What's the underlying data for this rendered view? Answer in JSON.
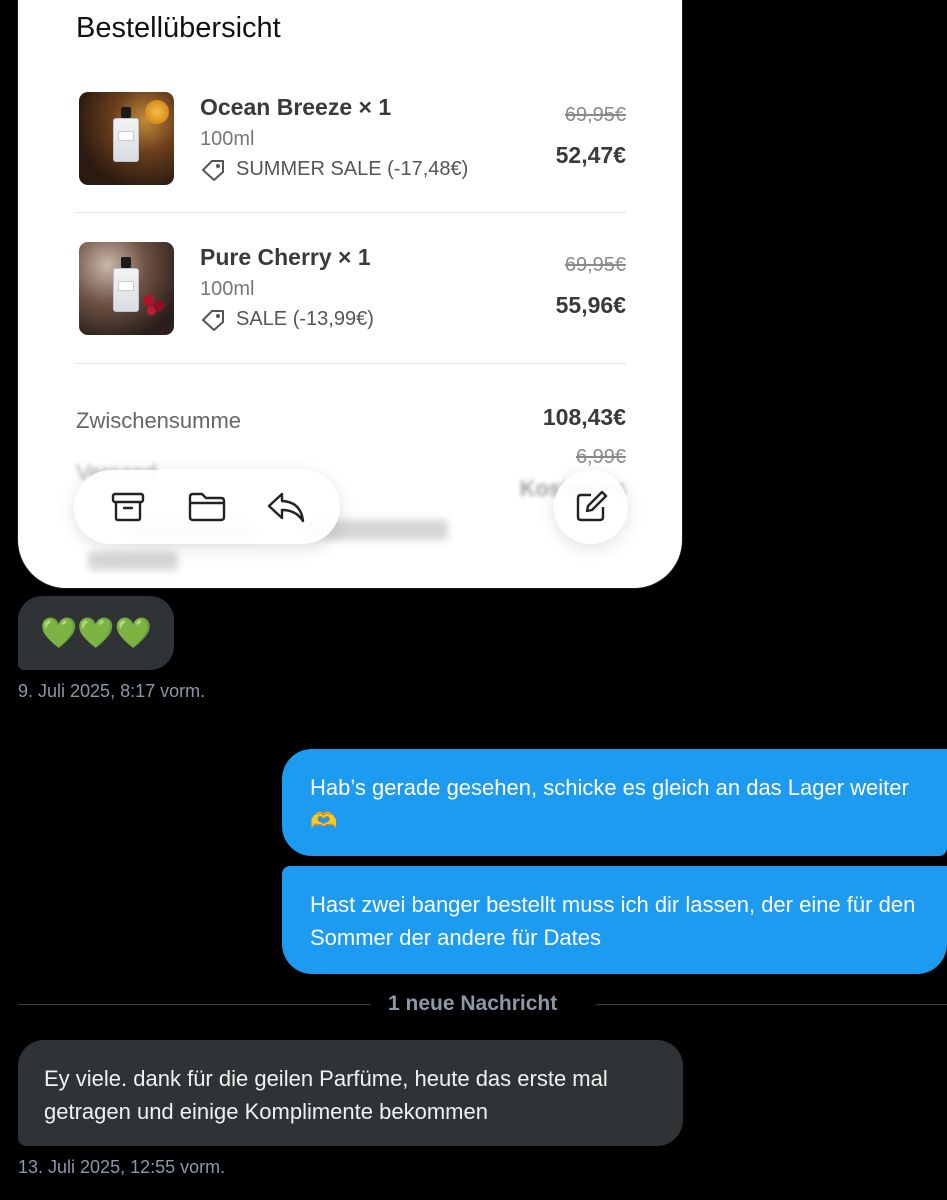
{
  "order": {
    "title": "Bestellübersicht",
    "items": [
      {
        "name": "Ocean Breeze × 1",
        "size": "100ml",
        "discount": "SUMMER SALE (-17,48€)",
        "price_old": "69,95€",
        "price_new": "52,47€"
      },
      {
        "name": "Pure Cherry × 1",
        "size": "100ml",
        "discount": "SALE (-13,99€)",
        "price_old": "69,95€",
        "price_new": "55,96€"
      }
    ],
    "subtotal_label": "Zwischensumme",
    "subtotal_value": "108,43€",
    "shipping_label": "Versand",
    "shipping_old": "6,99€",
    "shipping_free": "Kostenlos"
  },
  "toolbar": {
    "icons": [
      "archive-icon",
      "folder-icon",
      "reply-icon"
    ],
    "compose_icon": "compose-icon"
  },
  "chat": {
    "hearts": "💚💚💚",
    "timestamp1": "9. Juli 2025, 8:17 vorm.",
    "out1": "Hab’s gerade gesehen, schicke es gleich an das Lager weiter 🫶",
    "out2": "Hast zwei banger bestellt muss ich dir lassen, der eine für den Sommer der andere für Dates",
    "new_divider": "1 neue Nachricht",
    "in2": "Ey viele. dank für die geilen Parfüme, heute das erste mal getragen und einige Komplimente bekommen",
    "timestamp2": "13. Juli 2025, 12:55 vorm."
  },
  "colors": {
    "background": "#000000",
    "incoming_bubble": "#2f3336",
    "outgoing_bubble": "#1d9bf0",
    "timestamp": "#8b98a5",
    "hearts": "#6cc04a"
  }
}
